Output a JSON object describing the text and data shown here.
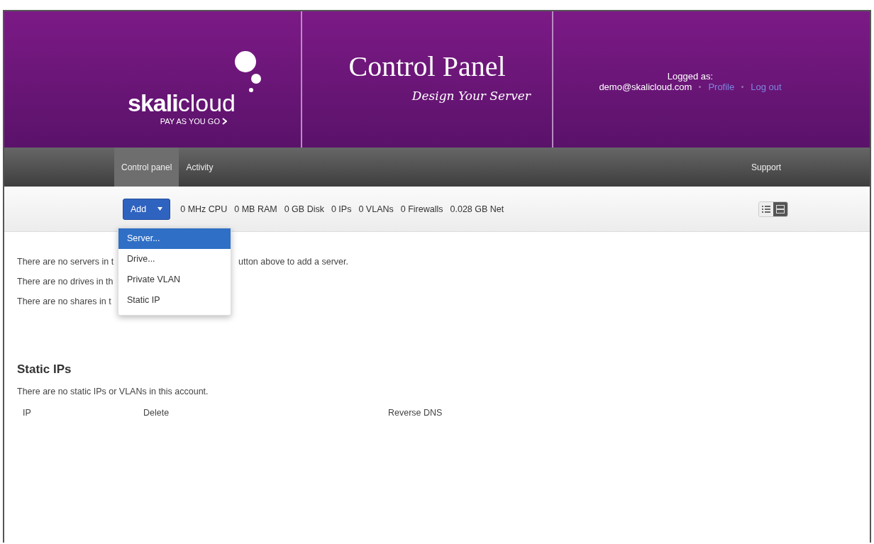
{
  "header": {
    "logo": {
      "brand_bold": "skali",
      "brand_light": "cloud",
      "tagline": "PAY AS YOU GO"
    },
    "title": "Control Panel",
    "subtitle": "Design Your Server",
    "account": {
      "label": "Logged as:",
      "email": "demo@skalicloud.com",
      "links": [
        "Profile",
        "Log out"
      ]
    }
  },
  "nav": {
    "items": [
      {
        "label": "Control panel",
        "selected": true
      },
      {
        "label": "Activity",
        "selected": false
      }
    ],
    "right": "Support"
  },
  "toolbar": {
    "add_button": "Add",
    "stats": [
      "0 MHz CPU",
      "0 MB RAM",
      "0 GB Disk",
      "0 IPs",
      "0 VLANs",
      "0 Firewalls",
      "0.028 GB Net"
    ],
    "view_toggle": [
      {
        "kind": "list",
        "selected": false
      },
      {
        "kind": "grid",
        "selected": true
      }
    ]
  },
  "add_menu": [
    {
      "label": "Server...",
      "selected": true
    },
    {
      "label": "Drive...",
      "selected": false
    },
    {
      "label": "Private VLAN",
      "selected": false
    },
    {
      "label": "Static IP",
      "selected": false
    }
  ],
  "messages": [
    {
      "before": "There are no servers in t",
      "after": "utton above to add a server."
    },
    {
      "before": "There are no drives in th"
    },
    {
      "before": "There are no shares in t"
    }
  ],
  "static_ips": {
    "heading": "Static IPs",
    "message": "There are no static IPs or VLANs in this account.",
    "columns": [
      "IP",
      "Delete",
      "Reverse DNS"
    ]
  }
}
